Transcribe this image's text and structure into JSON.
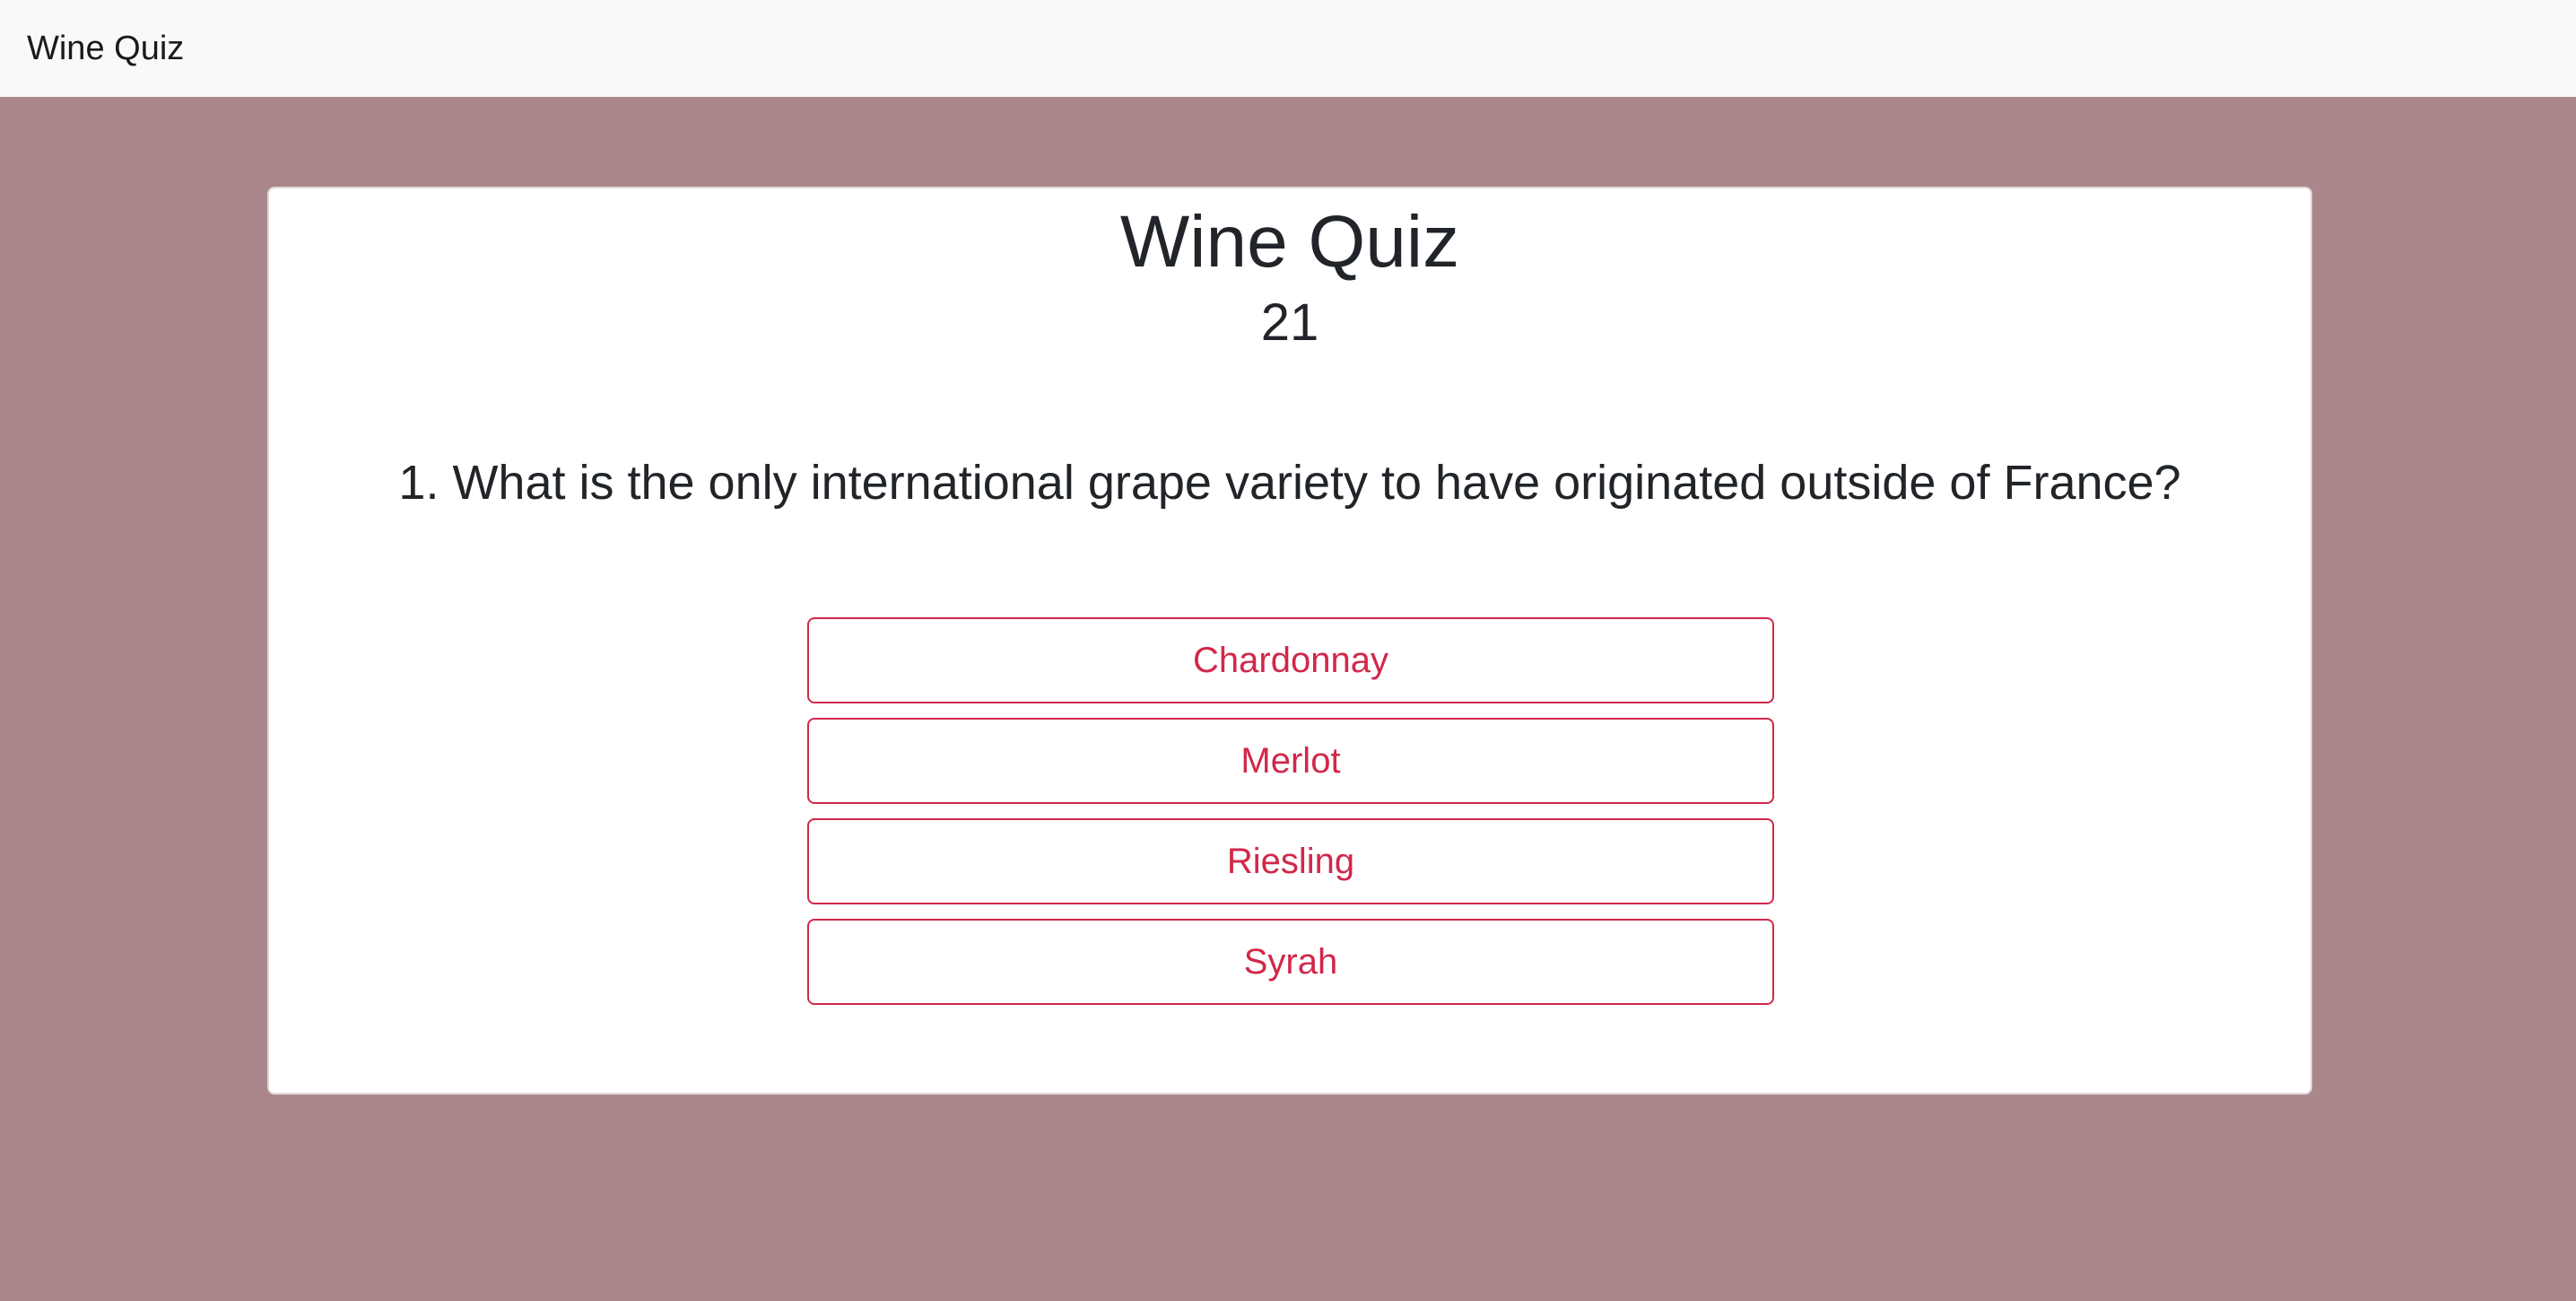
{
  "navbar": {
    "brand": "Wine Quiz"
  },
  "quiz": {
    "title": "Wine Quiz",
    "score": "21",
    "question": "1. What is the only international grape variety to have originated outside of France?",
    "answers": [
      {
        "label": "Chardonnay"
      },
      {
        "label": "Merlot"
      },
      {
        "label": "Riesling"
      },
      {
        "label": "Syrah"
      }
    ]
  },
  "colors": {
    "page_background": "#aa878a",
    "navbar_background": "#f8f9fa",
    "accent": "#d1284a",
    "card_background": "#ffffff"
  }
}
